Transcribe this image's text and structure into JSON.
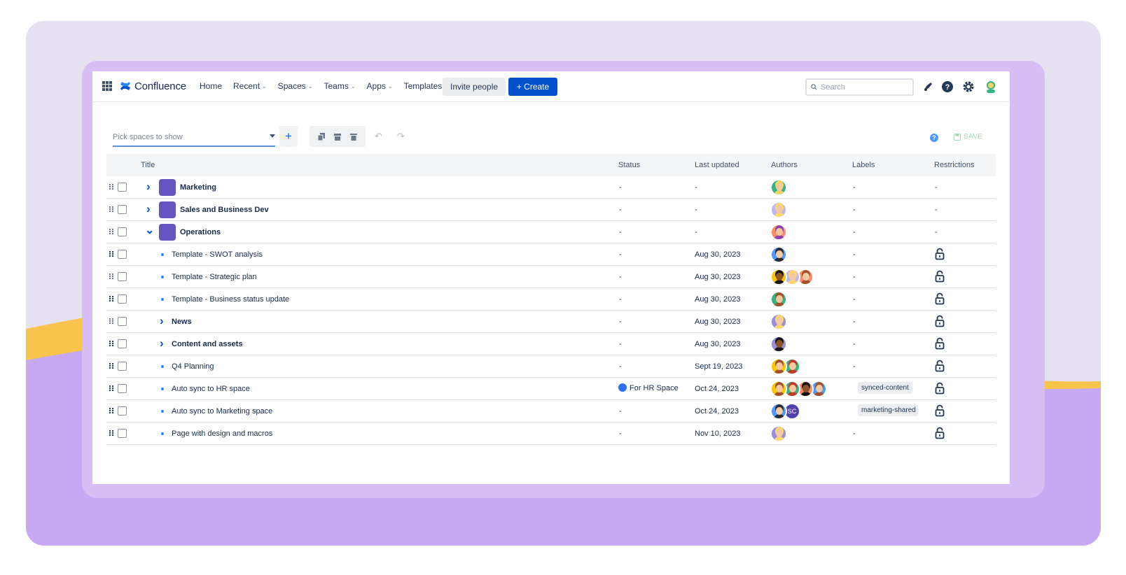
{
  "nav": {
    "logo_text": "Confluence",
    "items": [
      {
        "label": "Home",
        "dropdown": false
      },
      {
        "label": "Recent",
        "dropdown": true
      },
      {
        "label": "Spaces",
        "dropdown": true
      },
      {
        "label": "Teams",
        "dropdown": true
      },
      {
        "label": "Apps",
        "dropdown": true
      },
      {
        "label": "Templates",
        "dropdown": false
      }
    ],
    "invite_label": "Invite people",
    "create_label": "Create",
    "search_placeholder": "Search"
  },
  "toolbar": {
    "picker_placeholder": "Pick spaces to show",
    "save_label": "SAVE"
  },
  "table": {
    "columns": [
      "Title",
      "Status",
      "Last updated",
      "Authors",
      "Labels",
      "Restrictions"
    ],
    "rows": [
      {
        "title": "Marketing",
        "bold": true,
        "level": 0,
        "expander": "collapsed",
        "status": "-",
        "updated": "-",
        "labels": "-",
        "restrictions": "-",
        "locked": false,
        "space_icon_color": "#6554c0"
      },
      {
        "title": "Sales and Business Dev",
        "bold": true,
        "level": 0,
        "expander": "collapsed",
        "status": "-",
        "updated": "-",
        "labels": "-",
        "restrictions": "-",
        "locked": false,
        "space_icon_color": "#6554c0"
      },
      {
        "title": "Operations",
        "bold": true,
        "level": 0,
        "expander": "expanded",
        "status": "-",
        "updated": "-",
        "labels": "-",
        "restrictions": "-",
        "locked": false,
        "space_icon_color": "#6554c0"
      },
      {
        "title": "Template - SWOT analysis",
        "bold": false,
        "level": 1,
        "expander": "bullet",
        "status": "-",
        "updated": "Aug 30, 2023",
        "labels": "-",
        "locked": true
      },
      {
        "title": "Template - Strategic plan",
        "bold": false,
        "level": 1,
        "expander": "bullet",
        "status": "-",
        "updated": "Aug 30, 2023",
        "labels": "-",
        "locked": true
      },
      {
        "title": "Template - Business status update",
        "bold": false,
        "level": 1,
        "expander": "bullet",
        "status": "-",
        "updated": "Aug 30, 2023",
        "labels": "-",
        "locked": true
      },
      {
        "title": "News",
        "bold": true,
        "level": 1,
        "expander": "collapsed",
        "status": "-",
        "updated": "Aug 30, 2023",
        "labels": "-",
        "locked": true
      },
      {
        "title": "Content and assets",
        "bold": true,
        "level": 1,
        "expander": "collapsed",
        "status": "-",
        "updated": "Aug 30, 2023",
        "labels": "-",
        "locked": true
      },
      {
        "title": "Q4 Planning",
        "bold": false,
        "level": 1,
        "expander": "bullet",
        "status": "-",
        "updated": "Sept 19, 2023",
        "labels": "-",
        "locked": true
      },
      {
        "title": "Auto sync to HR space",
        "bold": false,
        "level": 1,
        "expander": "bullet",
        "status": "For HR Space",
        "status_color": "#2f6df6",
        "updated": "Oct 24, 2023",
        "labels": "synced-content",
        "label_chip": true,
        "locked": true
      },
      {
        "title": "Auto sync to Marketing space",
        "bold": false,
        "level": 1,
        "expander": "bullet",
        "status": "-",
        "updated": "Oct 24, 2023",
        "labels": "marketing-shared",
        "label_chip": true,
        "locked": true
      },
      {
        "title": "Page with design and macros",
        "bold": false,
        "level": 1,
        "expander": "bullet",
        "status": "-",
        "updated": "Nov 10, 2023",
        "labels": "-",
        "locked": true
      }
    ],
    "avatars": [
      [
        {
          "bg": "#36b37e",
          "skin": "#f5c9a0",
          "hair": "#f6d365"
        }
      ],
      [
        {
          "bg": "#c0b6f2",
          "skin": "#f5c9a0",
          "hair": "#ffd76b"
        }
      ],
      [
        {
          "bg": "#ff8b6b",
          "skin": "#f5c9a0",
          "hair": "#8e44ad"
        }
      ],
      [
        {
          "bg": "#4c9aff",
          "skin": "#f5c9a0",
          "hair": "#2b2b2b"
        }
      ],
      [
        {
          "bg": "#ffc400",
          "skin": "#8d5524",
          "hair": "#111111"
        },
        {
          "bg": "#c0b6f2",
          "skin": "#f5c9a0",
          "hair": "#ffd76b"
        },
        {
          "bg": "#ff8b6b",
          "skin": "#f5c9a0",
          "hair": "#a0522d"
        }
      ],
      [
        {
          "bg": "#36b37e",
          "skin": "#f5c9a0",
          "hair": "#a0522d"
        }
      ],
      [
        {
          "bg": "#998dd9",
          "skin": "#f5c9a0",
          "hair": "#ffd76b"
        }
      ],
      [
        {
          "bg": "#998dd9",
          "skin": "#8d5524",
          "hair": "#111111"
        }
      ],
      [
        {
          "bg": "#ffc400",
          "skin": "#f5c9a0",
          "hair": "#a0522d"
        },
        {
          "bg": "#36b37e",
          "skin": "#f5c9a0",
          "hair": "#c0392b"
        }
      ],
      [
        {
          "bg": "#ffc400",
          "skin": "#f5c9a0",
          "hair": "#a0522d"
        },
        {
          "bg": "#36b37e",
          "skin": "#f5c9a0",
          "hair": "#c0392b"
        },
        {
          "bg": "#ff8b6b",
          "skin": "#8d5524",
          "hair": "#111111"
        },
        {
          "bg": "#4c9aff",
          "skin": "#f5c9a0",
          "hair": "#a0522d"
        }
      ],
      [
        {
          "bg": "#4c9aff",
          "skin": "#f5c9a0",
          "hair": "#2b2b2b"
        },
        {
          "initials": "SC",
          "bg": "#5243aa"
        }
      ],
      [
        {
          "bg": "#998dd9",
          "skin": "#f5c9a0",
          "hair": "#ffd76b"
        }
      ]
    ]
  },
  "colors": {
    "accent": "#0052cc",
    "frame": "#d7bff5",
    "background": "#e6e1f1",
    "wave_yellow": "#f8c44b",
    "wave_purple": "#c6a9f2"
  },
  "icons": {
    "app_switcher": "grid-icon",
    "logo": "confluence-logo-icon",
    "notifications": "rocket-icon",
    "help": "help-icon",
    "settings": "gear-icon",
    "profile": "avatar-icon",
    "restriction": "unlocked-icon"
  }
}
